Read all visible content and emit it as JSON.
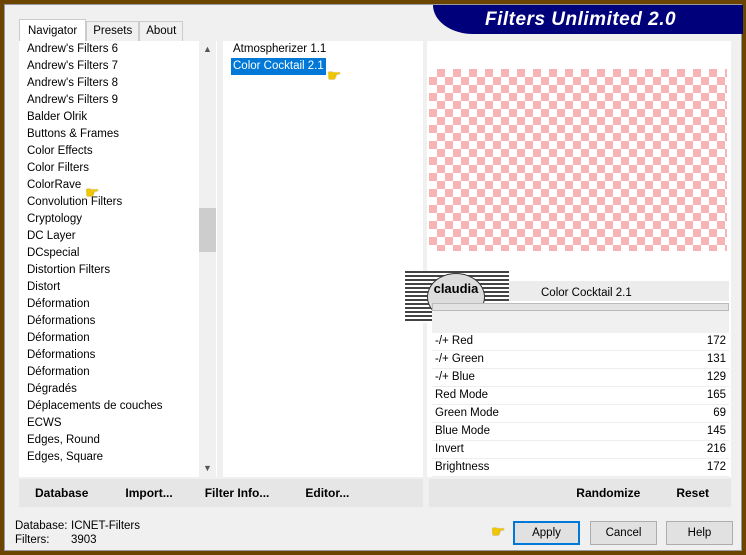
{
  "title": "Filters Unlimited 2.0",
  "tabs": [
    "Navigator",
    "Presets",
    "About"
  ],
  "categories": [
    "Andrew's Filters 6",
    "Andrew's Filters 7",
    "Andrew's Filters 8",
    "Andrew's Filters 9",
    "Balder Olrik",
    "Buttons & Frames",
    "Color Effects",
    "Color Filters",
    "ColorRave",
    "Convolution Filters",
    "Cryptology",
    "DC Layer",
    "DCspecial",
    "Distortion Filters",
    "Distort",
    "Déformation",
    "Déformations",
    "Déformation",
    "Déformations",
    "Déformation",
    "Dégradés",
    "Déplacements de couches",
    "ECWS",
    "Edges, Round",
    "Edges, Square"
  ],
  "filters": [
    "Atmospherizer 1.1",
    "Color Cocktail 2.1"
  ],
  "selected_filter": "Color Cocktail 2.1",
  "logo_text": "claudia",
  "params": [
    {
      "label": "-/+ Red",
      "value": "172"
    },
    {
      "label": "-/+ Green",
      "value": "131"
    },
    {
      "label": "-/+ Blue",
      "value": "129"
    },
    {
      "label": "Red Mode",
      "value": "165"
    },
    {
      "label": "Green Mode",
      "value": "69"
    },
    {
      "label": "Blue Mode",
      "value": "145"
    },
    {
      "label": "Invert",
      "value": "216"
    },
    {
      "label": "Brightness",
      "value": "172"
    }
  ],
  "left_buttons": [
    "Database",
    "Import...",
    "Filter Info...",
    "Editor..."
  ],
  "right_buttons": [
    "Randomize",
    "Reset"
  ],
  "status": {
    "db_label": "Database:",
    "db_value": "ICNET-Filters",
    "filters_label": "Filters:",
    "filters_value": "3903"
  },
  "dialog_buttons": {
    "apply": "Apply",
    "cancel": "Cancel",
    "help": "Help"
  },
  "icons": {
    "pointer": "hand-pointer-icon"
  }
}
